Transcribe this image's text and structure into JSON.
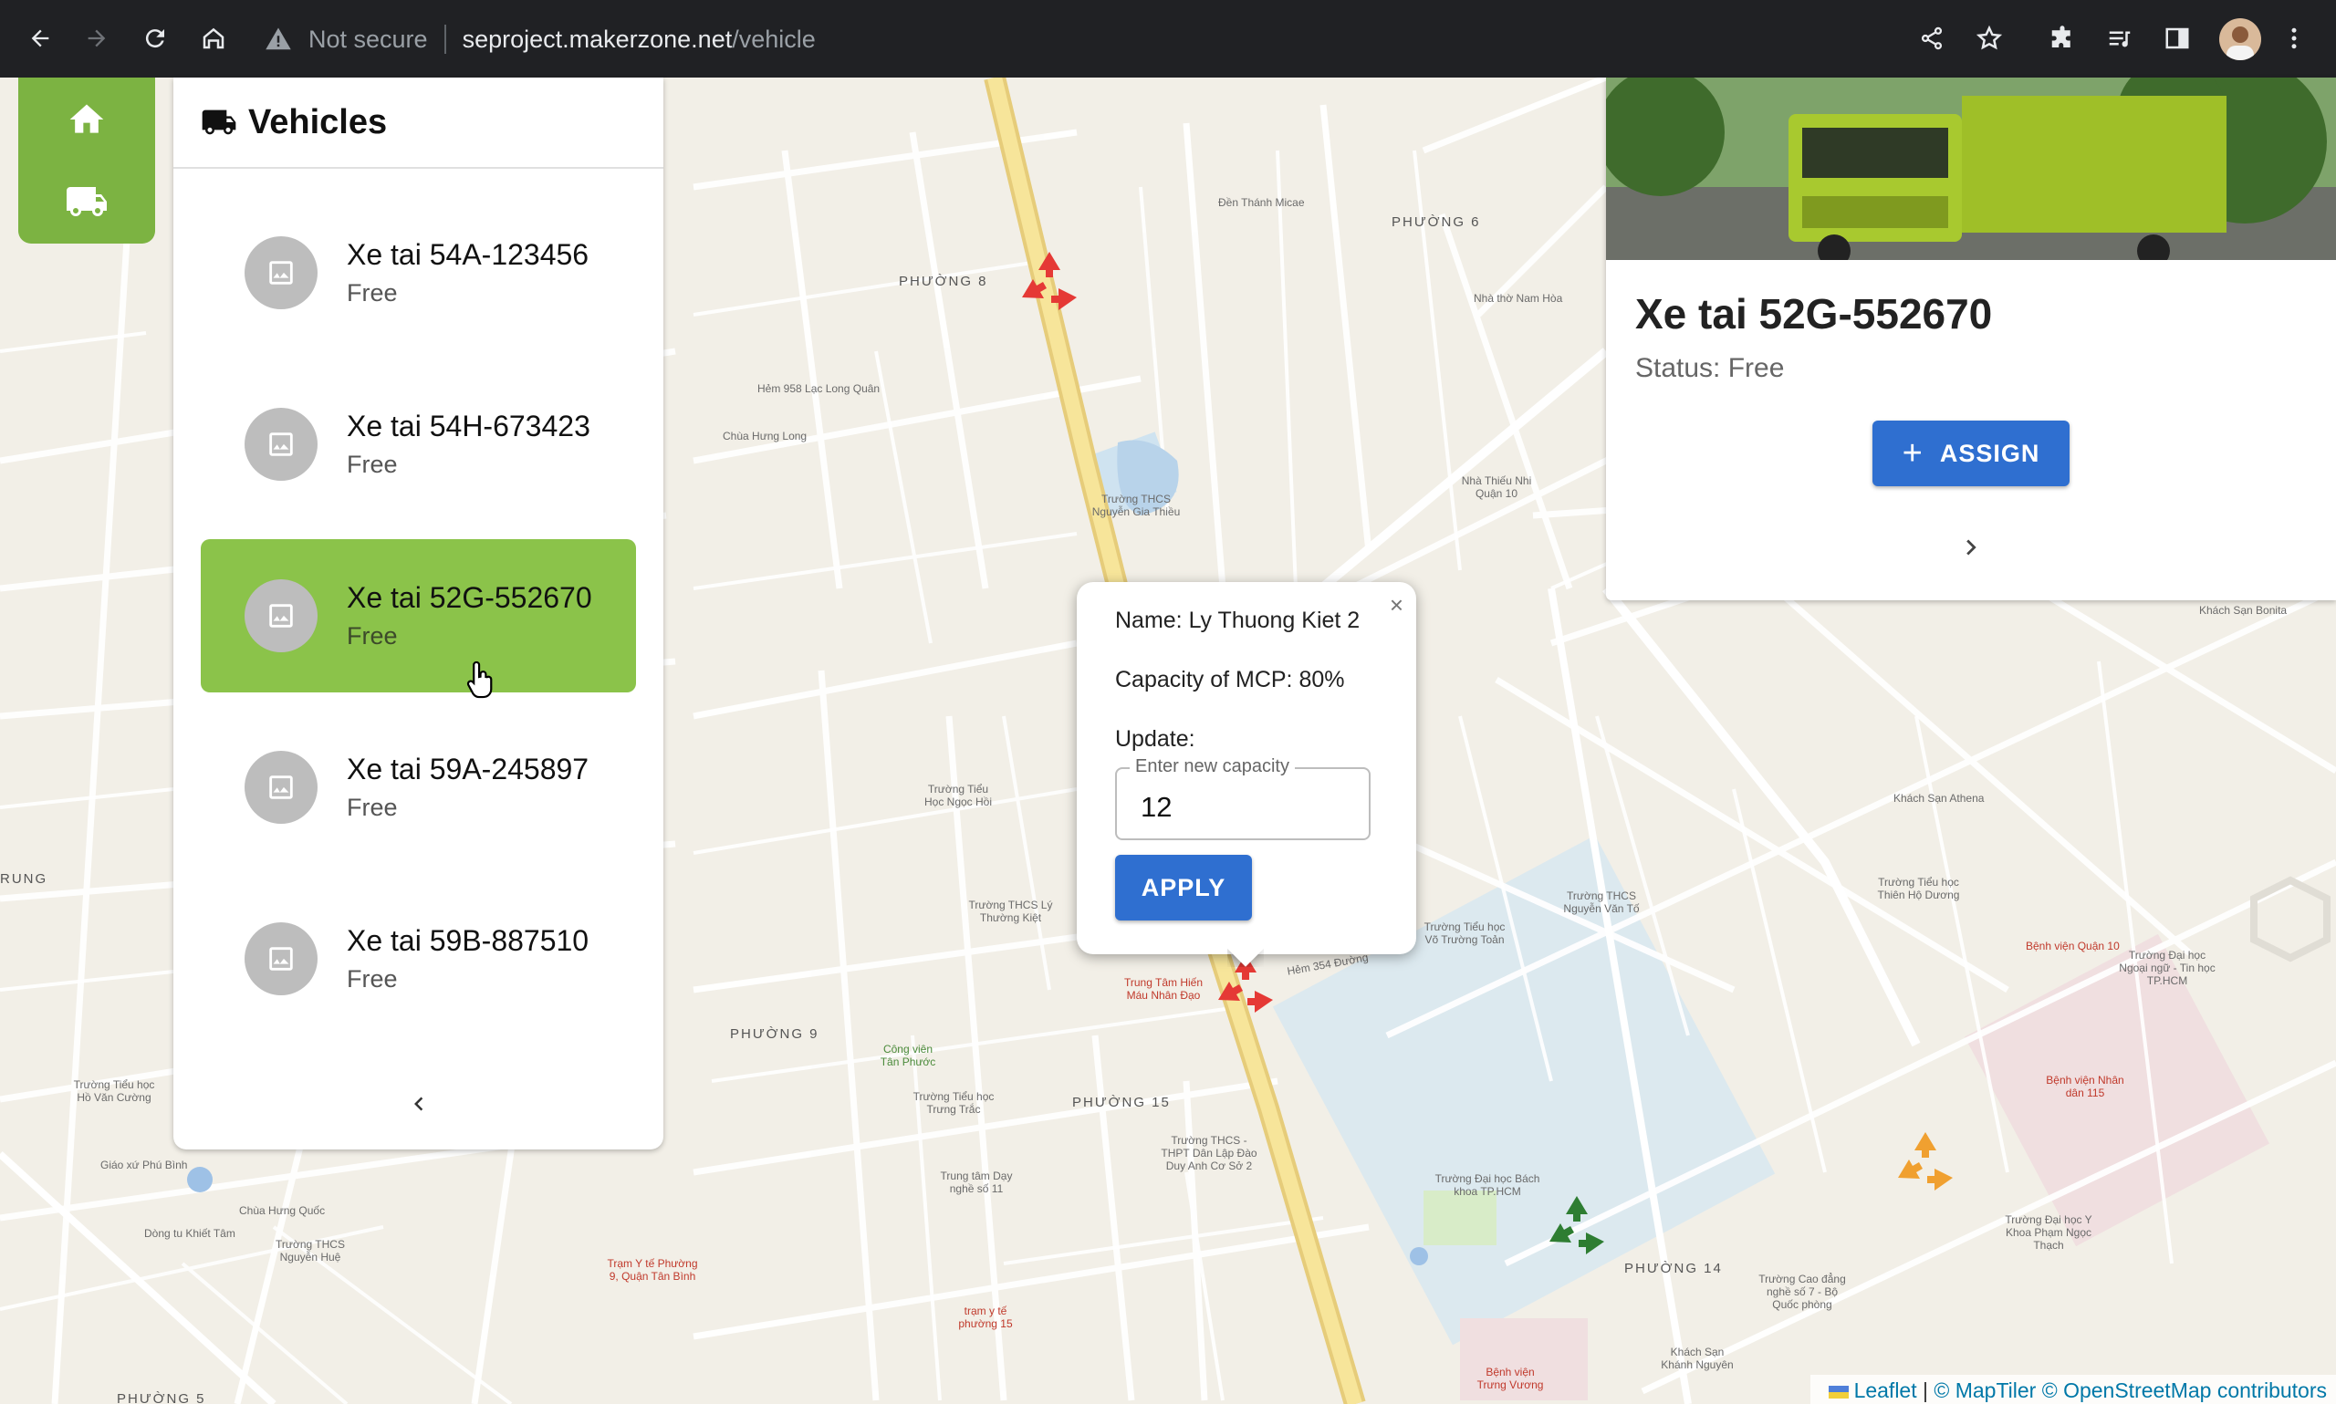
{
  "browser": {
    "not_secure": "Not secure",
    "url_host": "seproject.makerzone.net",
    "url_path": "/vehicle"
  },
  "panel": {
    "title": "Vehicles",
    "vehicles": [
      {
        "name": "Xe tai 54A-123456",
        "status": "Free"
      },
      {
        "name": "Xe tai 54H-673423",
        "status": "Free"
      },
      {
        "name": "Xe tai 52G-552670",
        "status": "Free",
        "selected": true
      },
      {
        "name": "Xe tai 59A-245897",
        "status": "Free"
      },
      {
        "name": "Xe tai 59B-887510",
        "status": "Free"
      }
    ]
  },
  "popup": {
    "name_line": "Name: Ly Thuong Kiet 2",
    "capacity_line": "Capacity of MCP: 80%",
    "update_label": "Update:",
    "field_label": "Enter new capacity",
    "field_value": "12",
    "apply_label": "APPLY",
    "close_symbol": "×"
  },
  "card": {
    "title": "Xe tai 52G-552670",
    "status": "Status: Free",
    "assign_label": "ASSIGN"
  },
  "attribution": {
    "leaflet": "Leaflet",
    "sep": " | ",
    "maptiler": "© MapTiler",
    "osm": "© OpenStreetMap contributors"
  },
  "map_labels": {
    "d8": "PHƯỜNG 8",
    "d6": "PHƯỜNG 6",
    "d9": "PHƯỜNG 9",
    "d15": "PHƯỜNG 15",
    "d14": "PHƯỜNG 14",
    "d5": "PHƯỜNG 5",
    "trung": "RUNG",
    "chua_hung_long": "Chùa Hưng Long",
    "hem958": "Hẻm 958 Lạc Long Quân",
    "thcs_ngt": "Trường THCS Nguyễn Gia Thiều",
    "th_ngochoi": "Trường Tiểu Học Ngọc Hồi",
    "thcs_ltk": "Trường THCS Lý Thường Kiệt",
    "cong_vien": "Công viên Tân Phước",
    "th_trungtrac": "Trường Tiểu học Trưng Trắc",
    "thcs_dld": "Trường THCS - THPT Dân Lập Đào Duy Anh Cơ Sở 2",
    "dhbk": "Trường Đại học Bách khoa TP.HCM",
    "bv_q10": "Bệnh viện Quận 10",
    "bv_115": "Bệnh viện Nhân dân 115",
    "dh_ngoaingu": "Trường Đại học Ngoại ngữ - Tin học TP.HCM",
    "ks_athena": "Khách Sạn Athena",
    "ks_bonita": "Khách Sạn Bonita",
    "th_thienho": "Trường Tiểu học Thiên Hộ Dương",
    "thcs_nvt": "Trường THCS Nguyễn Văn Tố",
    "th_vtt": "Trường Tiểu học Võ Trường Toản",
    "tt_hienmau": "Trung Tâm Hiến Máu Nhân Đạo",
    "tram_yte": "Trạm Y tế Phường 9, Quận Tân Bình",
    "tram_yte15": "trạm y tế phường 15",
    "hem354": "Hẻm 354 Đường",
    "th_hvc": "Trường Tiểu học Hồ Văn Cường",
    "giao_xu": "Giáo xứ Phú Bình",
    "chua_hq": "Chùa Hưng Quốc",
    "thcs_nh": "Trường THCS Nguyễn Huệ",
    "dong_tu": "Dòng tu Khiết Tâm",
    "dh_ykhoa": "Trường Đại học Y Khoa Phạm Ngọc Thạch",
    "bv_tv": "Bệnh viện Trưng Vương",
    "ks_kn": "Khách Sạn Khánh Nguyên",
    "nha_tho_nh": "Nhà thờ Nam Hòa",
    "den_micae": "Đền Thánh Micae",
    "nha_thieu": "Nhà Thiếu Nhi Quận 10",
    "cd_nghe": "Trường Cao đẳng nghề số 7 - Bộ Quốc phòng",
    "td_ngheso11": "Trung tâm Dạy nghề số 11"
  }
}
